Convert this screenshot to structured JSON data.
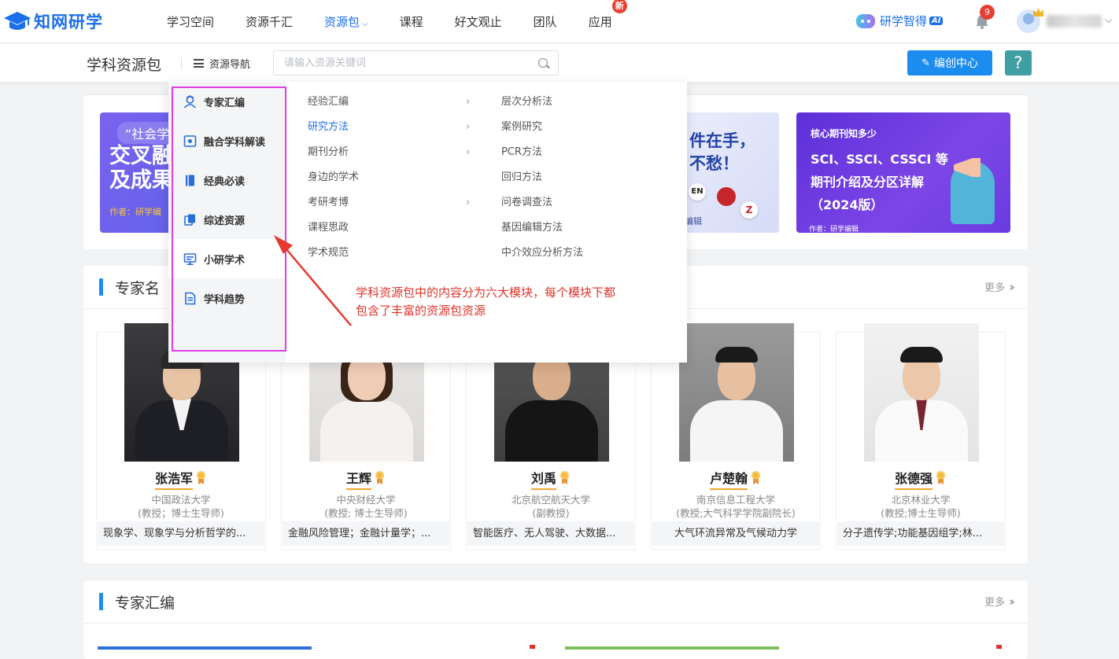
{
  "brand": {
    "logo_text": "知网研学"
  },
  "nav": {
    "items": [
      {
        "label": "学习空间"
      },
      {
        "label": "资源千汇"
      },
      {
        "label": "资源包",
        "active": true
      },
      {
        "label": "课程"
      },
      {
        "label": "好文观止"
      },
      {
        "label": "团队"
      },
      {
        "label": "应用",
        "badge": "新"
      }
    ],
    "ai_label": "研学智得",
    "ai_tag": "AI",
    "notification_count": "9"
  },
  "subbar": {
    "title": "学科资源包",
    "resource_nav": "资源导航",
    "search_placeholder": "请输入资源关键词",
    "create_button": "编创中心",
    "help": "?"
  },
  "banners": {
    "b1": {
      "quote": "“社会学",
      "line1": "交叉融",
      "line2": "及成果",
      "author": "作者：研学编"
    },
    "b2": {
      "line1": "件在手，",
      "line2": "不愁！",
      "en": "EN",
      "z": "Z",
      "editor": "编辑"
    },
    "b3": {
      "header": "核心期刊知多少",
      "line1": "SCI、SSCI、CSSCI 等",
      "line2": "期刊介绍及分区详解",
      "line3": "（2024版）",
      "editor": "作者：研学编辑"
    }
  },
  "experts_section": {
    "title": "专家名",
    "more": "更多",
    "experts": [
      {
        "name": "张浩军",
        "org": "中国政法大学",
        "title": "(教授；博士生导师)",
        "field": "现象学、现象学与分析哲学的..."
      },
      {
        "name": "王辉",
        "org": "中央财经大学",
        "title": "(教授; 博士生导师)",
        "field": "金融风险管理；金融计量学；..."
      },
      {
        "name": "刘禹",
        "org": "北京航空航天大学",
        "title": "(副教授)",
        "field": "智能医疗、无人驾驶、大数据..."
      },
      {
        "name": "卢楚翰",
        "org": "南京信息工程大学",
        "title": "(教授;大气科学学院副院长)",
        "field": "大气环流异常及气候动力学"
      },
      {
        "name": "张德强",
        "org": "北京林业大学",
        "title": "(教授;博士生导师)",
        "field": "分子遗传学;功能基因组学;林..."
      }
    ]
  },
  "compile_section": {
    "title": "专家汇编",
    "more": "更多"
  },
  "dropdown": {
    "categories": [
      {
        "label": "专家汇编",
        "icon": "expert-icon"
      },
      {
        "label": "融合学科解读",
        "icon": "fusion-icon"
      },
      {
        "label": "经典必读",
        "icon": "book-icon"
      },
      {
        "label": "综述资源",
        "icon": "review-icon"
      },
      {
        "label": "小研学术",
        "icon": "monitor-icon"
      },
      {
        "label": "学科趋势",
        "icon": "document-icon"
      }
    ],
    "subitems": [
      {
        "label": "经验汇编",
        "arrow": true
      },
      {
        "label": "研究方法",
        "arrow": true,
        "active": true
      },
      {
        "label": "期刊分析",
        "arrow": true
      },
      {
        "label": "身边的学术",
        "arrow": false
      },
      {
        "label": "考研考博",
        "arrow": true
      },
      {
        "label": "课程思政",
        "arrow": false
      },
      {
        "label": "学术规范",
        "arrow": false
      }
    ],
    "methods": [
      "层次分析法",
      "案例研究",
      "PCR方法",
      "回归方法",
      "问卷调查法",
      "基因编辑方法",
      "中介效应分析方法"
    ]
  },
  "annotation": {
    "line1": "学科资源包中的内容分为六大模块，每个模块下都",
    "line2": "包含了丰富的资源包资源"
  },
  "colors": {
    "brand": "#1b6fe8",
    "accent": "#1b8cf0",
    "highlight_box": "#e23ce6",
    "annotation": "#e0332a",
    "badge": "#e83e32"
  }
}
